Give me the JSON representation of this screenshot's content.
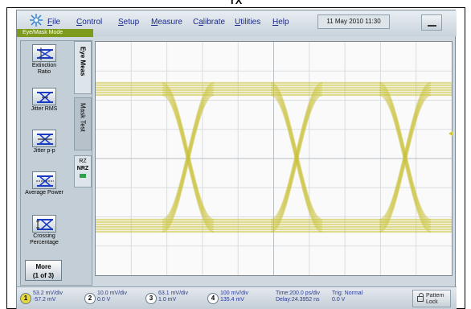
{
  "document": {
    "title": "TX"
  },
  "menubar": {
    "items": [
      {
        "label": "File",
        "underline": "F",
        "rest": "ile"
      },
      {
        "label": "Control",
        "underline": "C",
        "rest": "ontrol"
      },
      {
        "label": "Setup",
        "underline": "S",
        "rest": "etup"
      },
      {
        "label": "Measure",
        "underline": "M",
        "rest": "easure"
      },
      {
        "label": "Calibrate",
        "underline": "a",
        "pre": "C",
        "rest": "librate"
      },
      {
        "label": "Utilities",
        "underline": "U",
        "rest": "tilities"
      },
      {
        "label": "Help",
        "underline": "H",
        "rest": "elp"
      }
    ],
    "datetime": "11 May 2010  11:30",
    "mode": "Eye/Mask Mode",
    "logo_icon": "starburst-icon"
  },
  "left_panel": {
    "buttons": [
      {
        "label": "Extinction Ratio",
        "icon": "extinction-ratio-icon"
      },
      {
        "label": "Jitter RMS",
        "icon": "jitter-rms-icon"
      },
      {
        "label": "Jitter p-p",
        "icon": "jitter-pp-icon"
      },
      {
        "label": "Average Power",
        "icon": "average-power-icon"
      },
      {
        "label": "Crossing Percentage",
        "icon": "crossing-percentage-icon"
      }
    ],
    "more_line1": "More",
    "more_line2": "(1 of 3)",
    "tabs": {
      "eye_meas": "Eye Meas",
      "mask_test": "Mask Test"
    },
    "rz": "RZ",
    "nrz": "NRZ"
  },
  "display": {
    "trace_color": "#c9c23a",
    "grid_color": "#d9dde0",
    "background": "#fafafa"
  },
  "statusbar": {
    "channels": [
      {
        "num": "1",
        "scale": "53.2 mV/div",
        "offset": "-57.2 mV"
      },
      {
        "num": "2",
        "scale": "10.0 mV/div",
        "offset": "0.0 V"
      },
      {
        "num": "3",
        "scale": "63.1 mV/div",
        "offset": "1.0 mV"
      },
      {
        "num": "4",
        "scale": "100 mV/div",
        "offset": "135.4 mV"
      }
    ],
    "time_line1": "Time:200.0 ps/div",
    "time_line2": "Delay:24.3952 ns",
    "trig_line1": "Trig: Normal",
    "trig_line2": "0.0 V",
    "pattern_line1": "Pattern",
    "pattern_line2": "Lock"
  }
}
